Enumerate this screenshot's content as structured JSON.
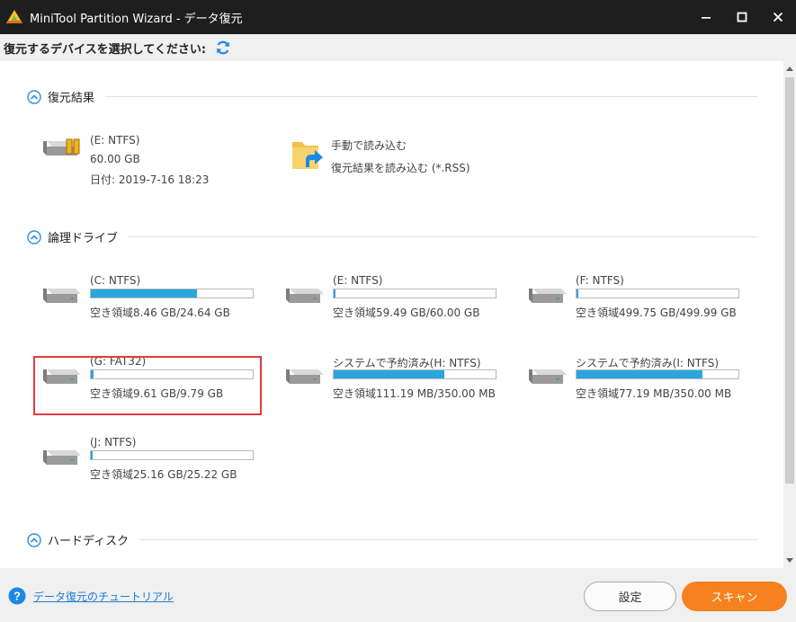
{
  "window": {
    "title": "MiniTool Partition Wizard - データ復元",
    "app_icon": "minitool-logo-icon",
    "controls": [
      "minimize-icon",
      "maximize-icon",
      "close-icon"
    ]
  },
  "instruction": {
    "text": "復元するデバイスを選択してください:",
    "icon": "refresh-icon",
    "accent": "#1e88e5"
  },
  "sections": {
    "recovery_results": {
      "title": "復元結果",
      "items": [
        {
          "name": "(E: NTFS)",
          "size": "60.00 GB",
          "date": "日付: 2019-7-16 18:23",
          "icon": "drive-result-icon"
        },
        {
          "name": "手動で読み込む",
          "desc": "復元結果を読み込む (*.RSS)",
          "icon": "folder-load-icon"
        }
      ]
    },
    "logical_drives": {
      "title": "論理ドライブ",
      "items": [
        {
          "name": "(C: NTFS)",
          "free": "空き領域8.46 GB/24.64 GB",
          "used_fraction": 0.657
        },
        {
          "name": "(E: NTFS)",
          "free": "空き領域59.49 GB/60.00 GB",
          "used_fraction": 0.008
        },
        {
          "name": "(F: NTFS)",
          "free": "空き領域499.75 GB/499.99 GB",
          "used_fraction": 0.0005
        },
        {
          "name": "(G: FAT32)",
          "free": "空き領域9.61 GB/9.79 GB",
          "used_fraction": 0.018,
          "selected": true
        },
        {
          "name": "システムで予約済み(H: NTFS)",
          "free": "空き領域111.19 MB/350.00 MB",
          "used_fraction": 0.682
        },
        {
          "name": "システムで予約済み(I: NTFS)",
          "free": "空き領域77.19 MB/350.00 MB",
          "used_fraction": 0.779
        },
        {
          "name": "(J: NTFS)",
          "free": "空き領域25.16 GB/25.22 GB",
          "used_fraction": 0.002
        }
      ]
    },
    "hard_disks": {
      "title": "ハードディスク"
    }
  },
  "footer": {
    "help_link": "データ復元のチュートリアル",
    "settings_label": "設定",
    "scan_label": "スキャン",
    "scan_color": "#f5821f",
    "selection_color": "#e53a3a",
    "bar_color": "#2aa6df"
  }
}
